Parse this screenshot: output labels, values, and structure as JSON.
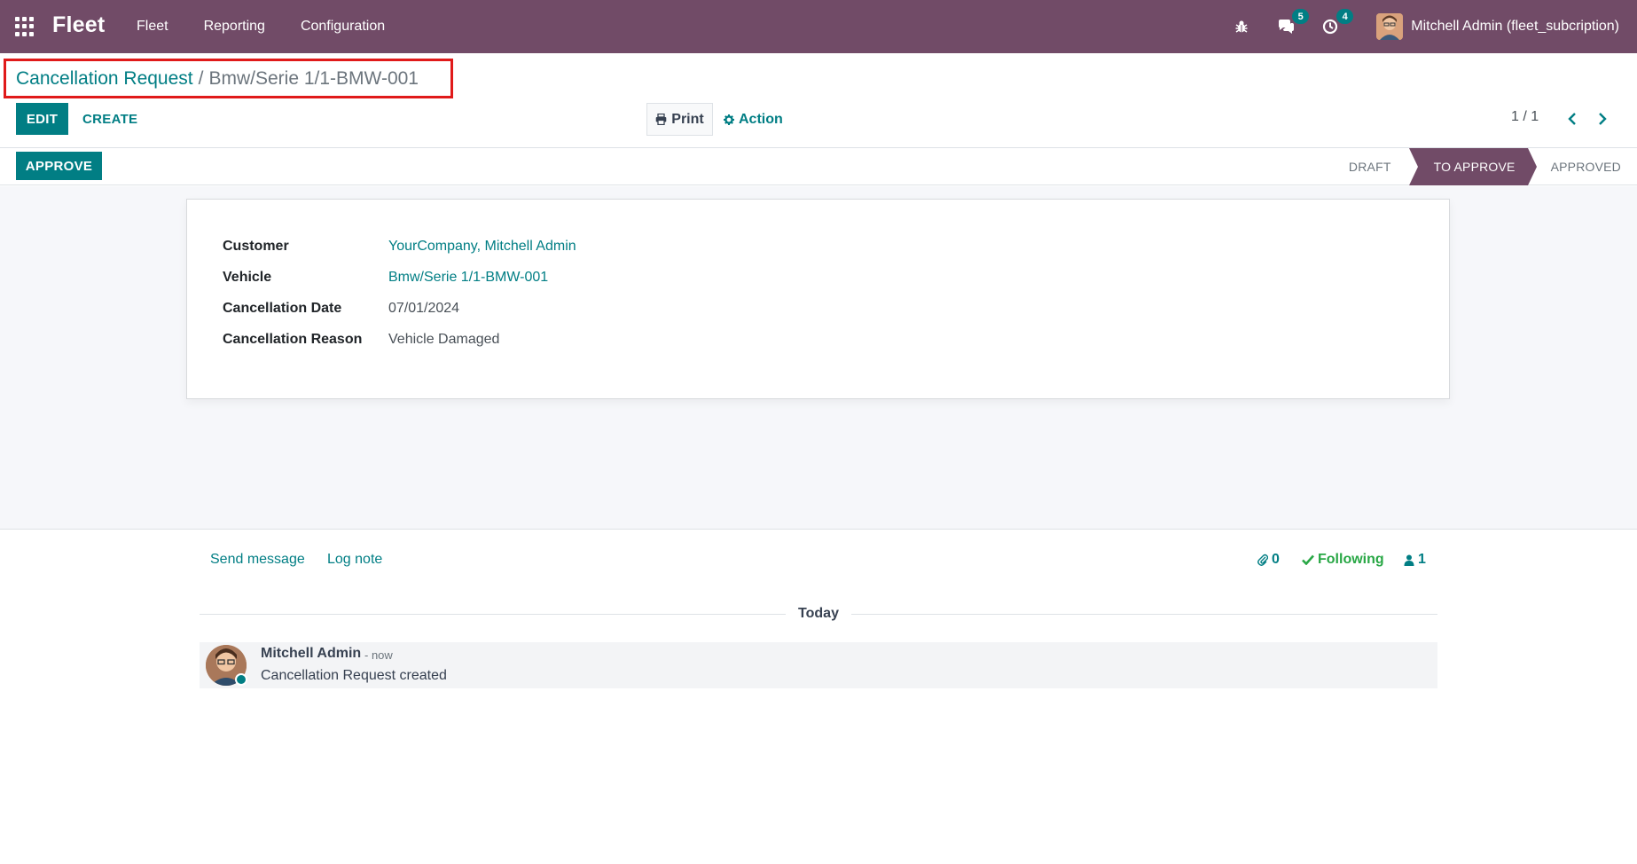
{
  "navbar": {
    "brand": "Fleet",
    "menu": [
      "Fleet",
      "Reporting",
      "Configuration"
    ],
    "messages_count": "5",
    "activities_count": "4",
    "user_name": "Mitchell Admin (fleet_subcription)"
  },
  "breadcrumb": {
    "parent": "Cancellation Request",
    "separator": "/",
    "current": "Bmw/Serie 1/1-BMW-001"
  },
  "control_panel": {
    "edit_label": "EDIT",
    "create_label": "CREATE",
    "print_label": "Print",
    "action_label": "Action",
    "pager": "1 / 1"
  },
  "statusbar": {
    "approve_label": "APPROVE",
    "stages": [
      "DRAFT",
      "TO APPROVE",
      "APPROVED"
    ],
    "active_stage": "TO APPROVE"
  },
  "form": {
    "fields": [
      {
        "label": "Customer",
        "value": "YourCompany, Mitchell Admin"
      },
      {
        "label": "Vehicle",
        "value": "Bmw/Serie 1/1-BMW-001"
      },
      {
        "label": "Cancellation Date",
        "value": "07/01/2024"
      },
      {
        "label": "Cancellation Reason",
        "value": "Vehicle Damaged"
      }
    ]
  },
  "chatter": {
    "send_message_label": "Send message",
    "log_note_label": "Log note",
    "attachments_count": "0",
    "following_label": "Following",
    "followers_count": "1",
    "date_separator": "Today",
    "messages": [
      {
        "author": "Mitchell Admin",
        "time": "- now",
        "body": "Cancellation Request created"
      }
    ]
  },
  "colors": {
    "brand": "#714B67",
    "accent": "#017E84",
    "highlight_border": "#e01a1a",
    "success": "#28a745"
  }
}
